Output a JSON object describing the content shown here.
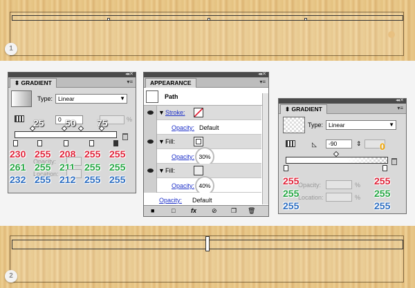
{
  "step1": "1",
  "step2": "2",
  "gradient_left": {
    "title": "GRADIENT",
    "type_label": "Type:",
    "type_value": "Linear",
    "angle": "0",
    "location_labels": [
      "25",
      "50",
      "75"
    ],
    "percent_sign": "%",
    "opacity_label": "Opacity:",
    "location_label": "Location:",
    "red": [
      "230",
      "255",
      "208",
      "255",
      "255"
    ],
    "green": [
      "261",
      "255",
      "211",
      "255",
      "255"
    ],
    "blue": [
      "232",
      "255",
      "212",
      "255",
      "255"
    ]
  },
  "appearance": {
    "title": "APPEARANCE",
    "path_label": "Path",
    "stroke_label": "Stroke:",
    "opacity_label": "Opacity:",
    "default_value": "Default",
    "fill_label": "Fill:",
    "fill1_opacity": "30%",
    "fill2_opacity": "40%"
  },
  "gradient_right": {
    "title": "GRADIENT",
    "type_label": "Type:",
    "type_value": "Linear",
    "angle": "-90",
    "location_callout": "0",
    "opacity_label": "Opacity:",
    "location_label": "Location:",
    "percent_sign": "%",
    "left_rgb": [
      "255",
      "255",
      "255"
    ],
    "right_rgb": [
      "255",
      "255",
      "255"
    ]
  },
  "colors": {
    "red": "#e0243a",
    "green": "#28a846",
    "blue": "#2e6fc2",
    "accent": "#f3a600"
  }
}
